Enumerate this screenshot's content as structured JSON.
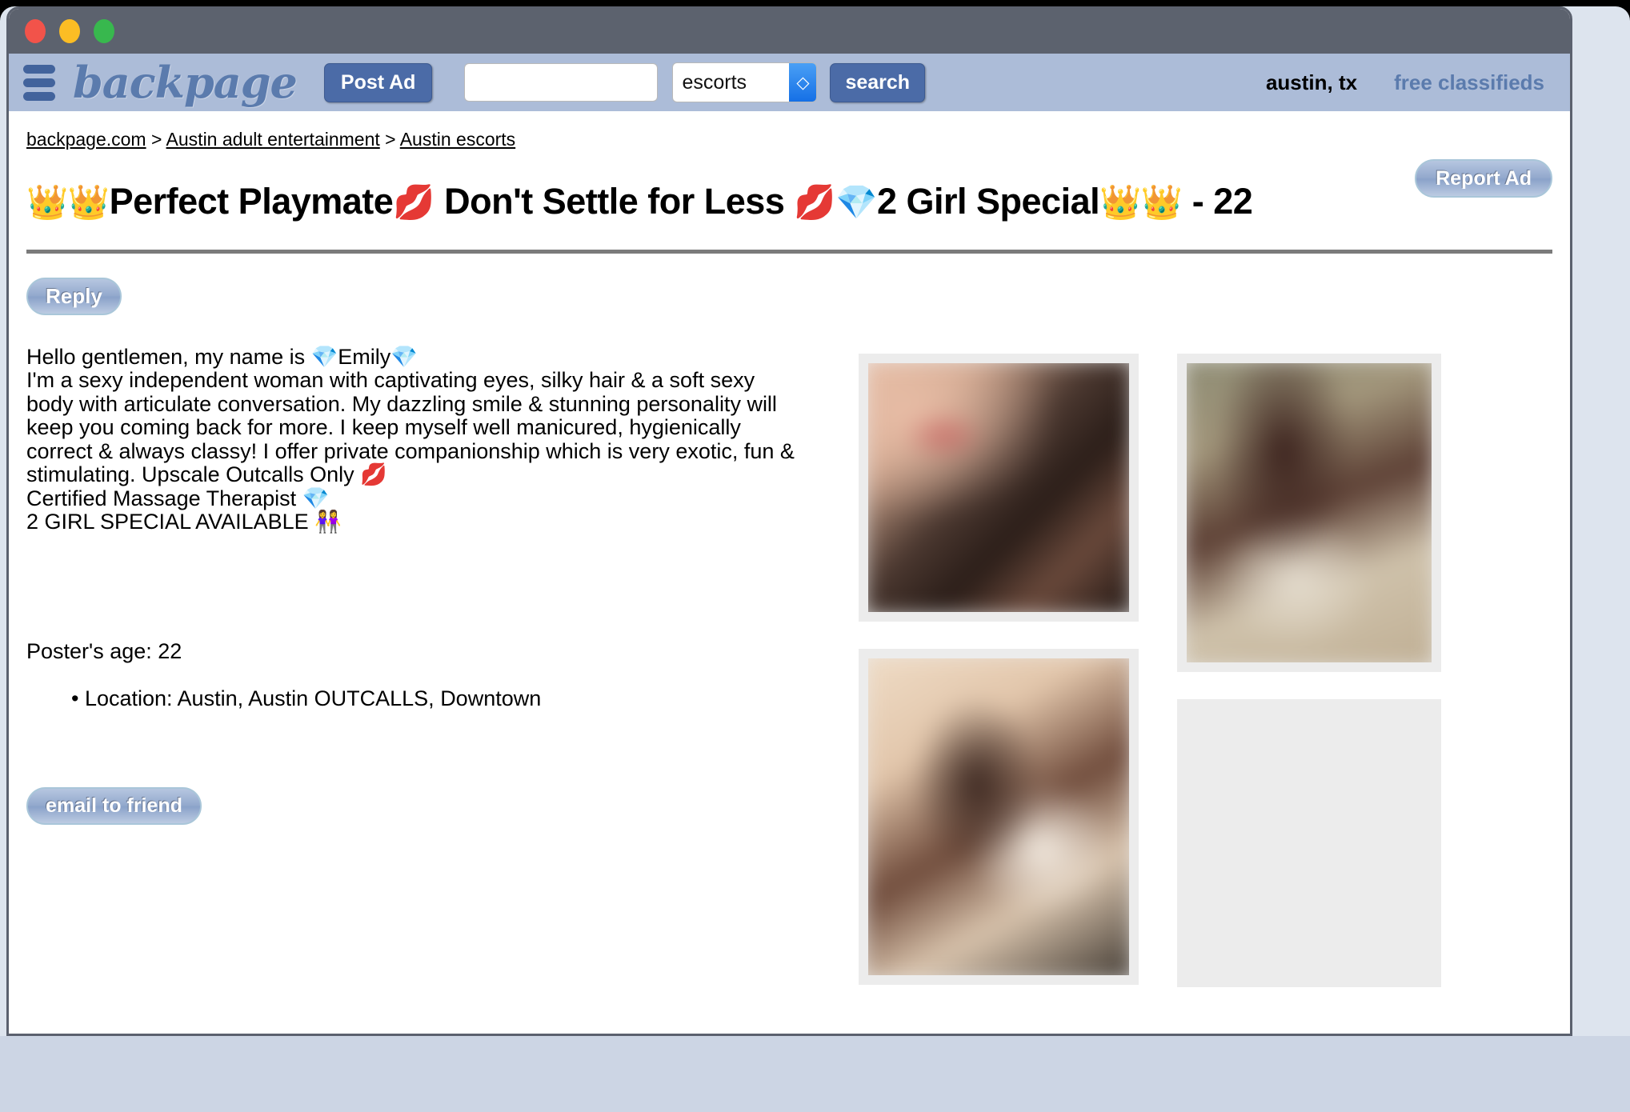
{
  "window": {
    "traffic_lights": [
      "close",
      "minimize",
      "maximize"
    ]
  },
  "header": {
    "menu_icon": "hamburger-icon",
    "brand": "backpage",
    "post_ad_label": "Post Ad",
    "search_value": "",
    "search_placeholder": "",
    "category_selected": "escorts",
    "category_options": [
      "escorts"
    ],
    "search_label": "search",
    "city": "austin, tx",
    "free_classifieds": "free classifieds"
  },
  "breadcrumb": {
    "items": [
      {
        "label": "backpage.com"
      },
      {
        "label": "Austin adult entertainment"
      },
      {
        "label": "Austin escorts"
      }
    ],
    "separator": ">"
  },
  "ad": {
    "report_label": "Report Ad",
    "title": "👑👑Perfect Playmate💋 Don't Settle for Less 💋💎2 Girl Special👑👑 - 22",
    "title_parts": {
      "crown1": "👑",
      "crown2": "👑",
      "text1": "Perfect Playmate",
      "kiss1": "💋",
      "text2": " Don't Settle for Less ",
      "kiss2": "💋",
      "gem1": "💎",
      "text3": "2 Girl Special",
      "crown3": "👑",
      "crown4": "👑",
      "text4": " - 22"
    },
    "reply_label": "Reply",
    "body_lines": [
      "Hello gentlemen, my name is 💎Emily💎",
      "I'm a sexy independent woman with captivating eyes, silky hair & a soft sexy",
      "body with articulate conversation. My dazzling smile & stunning personality will",
      "keep you coming back for more. I keep myself well manicured, hygienically",
      "correct & always classy! I offer private companionship which is very exotic, fun &",
      "stimulating. Upscale Outcalls Only 💋",
      "Certified Massage Therapist 💎",
      "2 GIRL SPECIAL AVAILABLE 👭"
    ],
    "poster_age": "Poster's age: 22",
    "location": "• Location: Austin, Austin OUTCALLS, Downtown",
    "email_friend_label": "email to friend",
    "photos": [
      {
        "name": "ad-photo-1",
        "style": "ph1"
      },
      {
        "name": "ad-photo-2",
        "style": "ph3"
      },
      {
        "name": "ad-photo-3",
        "style": "ph2"
      },
      {
        "name": "ad-photo-4",
        "style": "ph4"
      }
    ]
  },
  "colors": {
    "header_bar": "#acbcd8",
    "brand": "#5b7bad",
    "accent_button": "#4b6ba7",
    "titlebar": "#5c626e",
    "divider": "#7b7b7b",
    "desktop": "#dde4ee"
  }
}
